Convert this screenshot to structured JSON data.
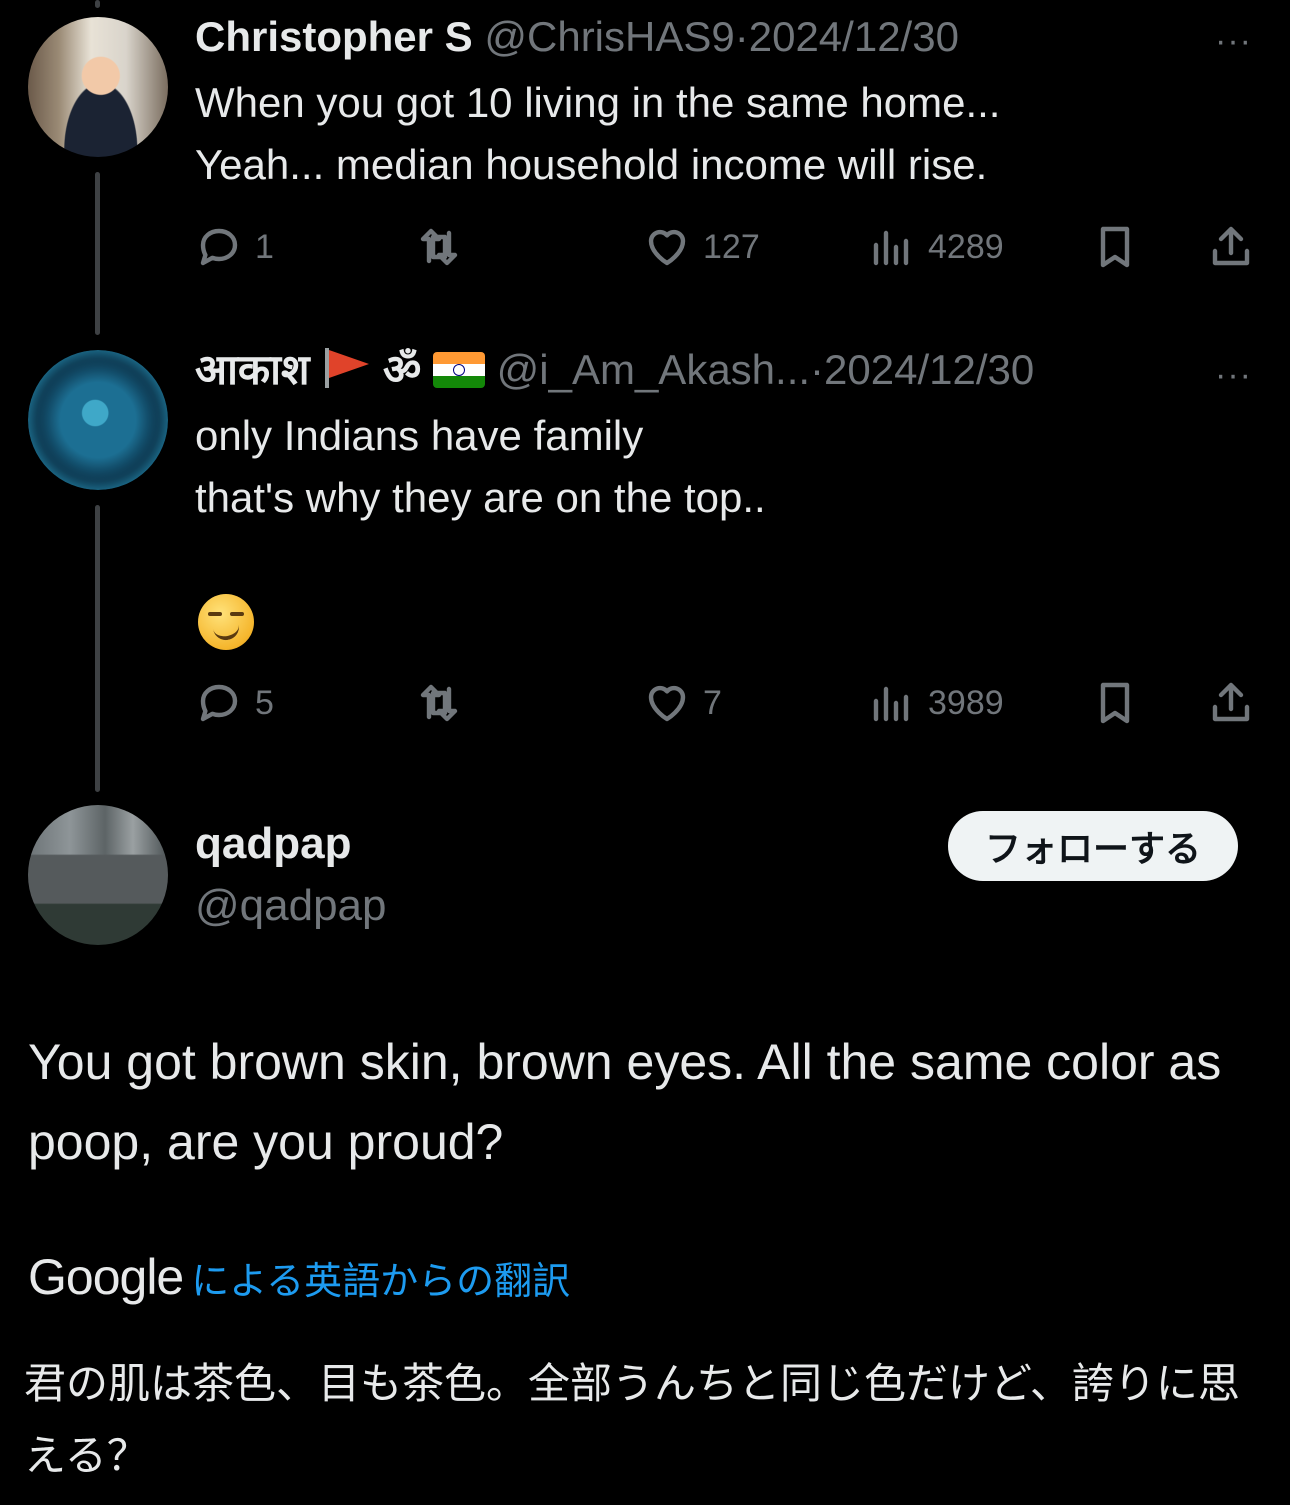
{
  "posts": [
    {
      "name": "Christopher S",
      "handle": "@ChrisHAS9",
      "separator": "·",
      "date": "2024/12/30",
      "more": "···",
      "text": "When you got 10 living in the same home...\nYeah... median household income will rise.",
      "stats": {
        "replies": "1",
        "retweets": "",
        "likes": "127",
        "views": "4289"
      }
    },
    {
      "name": "आकाश",
      "name_symbols": "ॐ",
      "handle": "@i_Am_Akash...",
      "separator": "·",
      "date": "2024/12/30",
      "more": "···",
      "text": "only Indians have family\nthat's why they are on the top..",
      "emoji": "smirking-face",
      "stats": {
        "replies": "5",
        "retweets": "",
        "likes": "7",
        "views": "3989"
      }
    }
  ],
  "main_post": {
    "name": "qadpap",
    "handle": "@qadpap",
    "follow_label": "フォローする",
    "text": "You got brown skin, brown eyes. All the same color as poop, are you proud?",
    "translation_brand": "Google",
    "translation_link": "による英語からの翻訳",
    "translated_text": "君の肌は茶色、目も茶色。全部うんちと同じ色だけど、誇りに思える？"
  },
  "colors": {
    "background": "#000000",
    "text": "#e7e9ea",
    "muted": "#71767b",
    "link": "#1d9bf0",
    "button_bg": "#eff3f4"
  }
}
